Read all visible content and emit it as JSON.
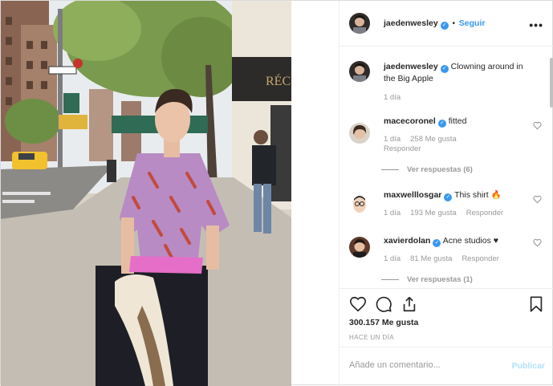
{
  "post": {
    "author": "jaedenwesley",
    "follow_separator": "•",
    "follow_label": "Seguir",
    "more_icon": "more-dots-icon",
    "verified_symbol": "✓"
  },
  "caption": {
    "username": "jaedenwesley",
    "text": "Clowning around in the Big Apple",
    "time": "1 día"
  },
  "comments": [
    {
      "username": "macecoronel",
      "text": "fitted",
      "time": "1 día",
      "likes": "258 Me gusta",
      "reply": "Responder",
      "view_replies": "Ver respuestas (6)"
    },
    {
      "username": "maxwelllosgar",
      "text": "This shirt 🔥",
      "time": "1 día",
      "likes": "193 Me gusta",
      "reply": "Responder"
    },
    {
      "username": "xavierdolan",
      "text": "Acne studios ♥",
      "time": "1 día",
      "likes": "81 Me gusta",
      "reply": "Responder",
      "view_replies": "Ver respuestas (1)"
    }
  ],
  "actions": {
    "like_icon": "heart-icon",
    "comment_icon": "comment-icon",
    "share_icon": "share-icon",
    "save_icon": "bookmark-icon"
  },
  "likes_count": "300.157 Me gusta",
  "posted": "HACE UN DÍA",
  "comment_box": {
    "placeholder": "Añade un comentario...",
    "publish_label": "Publicar"
  },
  "colors": {
    "link_blue": "#3897f0",
    "muted": "#999999",
    "publish_disabled": "#b2dffc",
    "shirt": "#b88bc4",
    "envelope": "#e56ec8"
  }
}
